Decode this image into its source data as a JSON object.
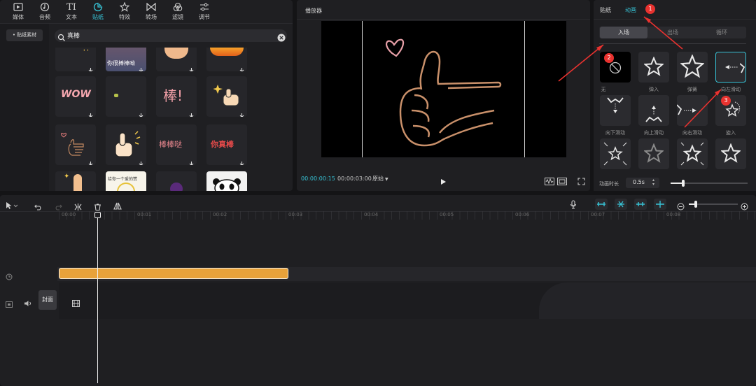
{
  "toolbar": {
    "items": [
      {
        "label": "媒体",
        "icon": "media-icon"
      },
      {
        "label": "音频",
        "icon": "audio-icon"
      },
      {
        "label": "文本",
        "icon": "text-icon"
      },
      {
        "label": "贴纸",
        "icon": "sticker-icon"
      },
      {
        "label": "特效",
        "icon": "effects-icon"
      },
      {
        "label": "转场",
        "icon": "transition-icon"
      },
      {
        "label": "滤镜",
        "icon": "filter-icon"
      },
      {
        "label": "调节",
        "icon": "adjust-icon"
      }
    ],
    "active_index": 3,
    "accent_color": "#37c3d6"
  },
  "sticker_panel": {
    "side_item": "• 贴纸素材",
    "search_value": "真棒",
    "tiles": [
      {
        "text": "",
        "kind": "sparkle"
      },
      {
        "text": "你很棒棒呦",
        "kind": "photo"
      },
      {
        "text": "",
        "kind": "fist"
      },
      {
        "text": "",
        "kind": "flame"
      },
      {
        "text": "WOW",
        "kind": "wow"
      },
      {
        "text": "",
        "kind": "tiny"
      },
      {
        "text": "棒!",
        "kind": "bang"
      },
      {
        "text": "",
        "kind": "thumb-sparkle"
      },
      {
        "text": "",
        "kind": "heart-thumb"
      },
      {
        "text": "",
        "kind": "cartoon-thumb"
      },
      {
        "text": "棒棒哒",
        "kind": "bangbangda"
      },
      {
        "text": "你真棒",
        "kind": "nizhenbang"
      },
      {
        "text": "",
        "kind": "finger"
      },
      {
        "text": "给你一个爱的赞",
        "kind": "card"
      },
      {
        "text": "",
        "kind": "purple"
      },
      {
        "text": "",
        "kind": "panda"
      }
    ]
  },
  "player": {
    "title": "播放器",
    "current_time": "00:00:00:15",
    "total_time": "00:00:03:00",
    "ratio_label": "原始",
    "current_time_color": "#37c3d6"
  },
  "anim_panel": {
    "tabs": [
      "贴纸",
      "动画"
    ],
    "active_tab": 1,
    "sub_tabs": [
      "入场",
      "出场",
      "循环"
    ],
    "active_sub_tab": 0,
    "cells": [
      {
        "label": "无",
        "icon": "none-icon"
      },
      {
        "label": "弹入",
        "icon": "star-icon"
      },
      {
        "label": "弹簧",
        "icon": "star-icon"
      },
      {
        "label": "向左滑动",
        "icon": "slide-left-icon"
      },
      {
        "label": "向下滑动",
        "icon": "slide-down-icon"
      },
      {
        "label": "向上滑动",
        "icon": "slide-up-icon"
      },
      {
        "label": "向右滑动",
        "icon": "slide-right-icon"
      },
      {
        "label": "旋入",
        "icon": "rotate-in-icon"
      },
      {
        "label": "",
        "icon": "star-icon"
      },
      {
        "label": "",
        "icon": "star-icon"
      },
      {
        "label": "",
        "icon": "star-icon"
      },
      {
        "label": "",
        "icon": "star-icon"
      }
    ],
    "selected_index": 3,
    "duration_label": "动画时长",
    "duration_value": "0.5s",
    "markers": [
      "1",
      "2",
      "3"
    ],
    "marker_color": "#e8322f"
  },
  "timeline": {
    "ticks": [
      "00:00",
      "00:01",
      "00:02",
      "00:03",
      "00:04",
      "00:05",
      "00:06",
      "00:07",
      "00:08"
    ],
    "cover_label": "封面",
    "clip_color": "#e8a23a"
  }
}
